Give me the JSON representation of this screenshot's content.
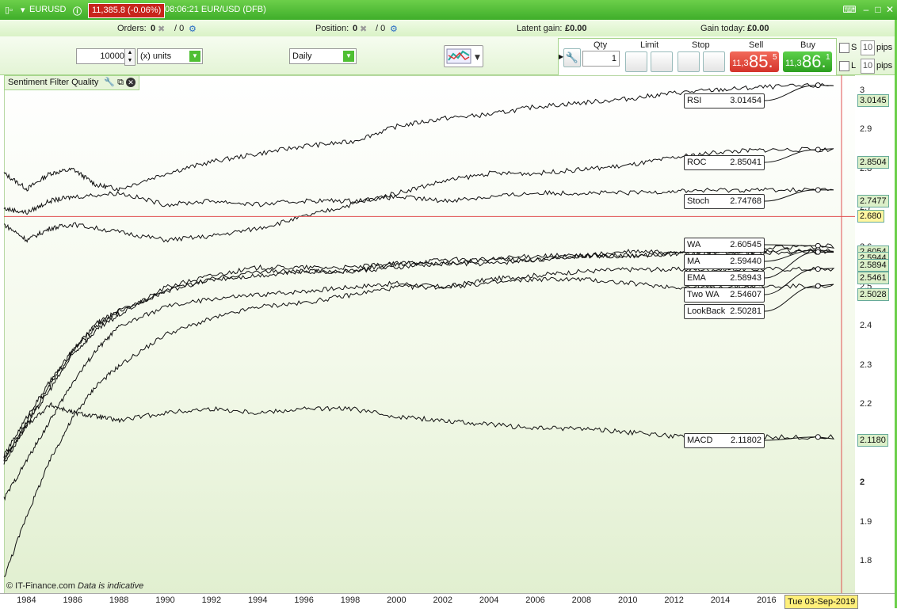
{
  "titlebar": {
    "instrument": "EURUSD",
    "price_change": "11,385.8 (-0.06%)",
    "time_info": "08:06:21 EUR/USD (DFB)"
  },
  "status": {
    "orders_label": "Orders:",
    "orders_value": "0",
    "orders_sep": "/ 0",
    "position_label": "Position:",
    "position_value": "0",
    "position_sep": "/ 0",
    "latent_label": "Latent gain:",
    "latent_value": "£0.00",
    "gain_label": "Gain today:",
    "gain_value": "£0.00"
  },
  "controls": {
    "quantity": "10000",
    "units": "(x) units",
    "timeframe": "Daily"
  },
  "trade": {
    "qty_label": "Qty",
    "qty_value": "1",
    "limit_label": "Limit",
    "stop_label": "Stop",
    "sell_label": "Sell",
    "buy_label": "Buy",
    "sell_small": "11,3",
    "sell_big": "85.",
    "sell_sup": "5",
    "buy_small": "11,3",
    "buy_big": "86.",
    "buy_sup": "1",
    "s_label": "S",
    "l_label": "L",
    "pips_value": "10",
    "pips_label": "pips"
  },
  "panel": {
    "title": "Sentiment Filter Quality"
  },
  "footer": {
    "copyright": "© IT-Finance.com",
    "note": "Data is indicative"
  },
  "crosshair": {
    "value": "2.680",
    "date": "Tue 03-Sep-2019"
  },
  "chart_data": {
    "type": "line",
    "x_range": [
      1983,
      2019.8
    ],
    "y_range": [
      1.72,
      3.04
    ],
    "x_ticks": [
      "1984",
      "1986",
      "1988",
      "1990",
      "1992",
      "1994",
      "1996",
      "1998",
      "2000",
      "2002",
      "2004",
      "2006",
      "2008",
      "2010",
      "2012",
      "2014",
      "2016"
    ],
    "y_ticks": [
      "3",
      "2.9",
      "2.8",
      "2.7",
      "2.6",
      "2.5",
      "2.4",
      "2.3",
      "2.2",
      "2.1",
      "2",
      "1.9",
      "1.8"
    ],
    "series": [
      {
        "name": "RSI",
        "last": "3.01454",
        "axis": "3.0145",
        "points": [
          [
            1983,
            2.79
          ],
          [
            1984,
            2.75
          ],
          [
            1985,
            2.79
          ],
          [
            1986,
            2.8
          ],
          [
            1987,
            2.76
          ],
          [
            1988,
            2.75
          ],
          [
            1990,
            2.79
          ],
          [
            1992,
            2.82
          ],
          [
            1994,
            2.84
          ],
          [
            1996,
            2.86
          ],
          [
            1998,
            2.87
          ],
          [
            2000,
            2.91
          ],
          [
            2002,
            2.93
          ],
          [
            2004,
            2.94
          ],
          [
            2006,
            2.96
          ],
          [
            2008,
            2.97
          ],
          [
            2010,
            2.98
          ],
          [
            2012,
            2.995
          ],
          [
            2014,
            3.003
          ],
          [
            2016,
            3.01
          ],
          [
            2019,
            3.0145
          ]
        ]
      },
      {
        "name": "ROC",
        "last": "2.85041",
        "axis": "2.8504",
        "points": [
          [
            1983,
            2.66
          ],
          [
            1984,
            2.62
          ],
          [
            1985,
            2.65
          ],
          [
            1986,
            2.66
          ],
          [
            1988,
            2.64
          ],
          [
            1990,
            2.62
          ],
          [
            1992,
            2.63
          ],
          [
            1994,
            2.65
          ],
          [
            1996,
            2.68
          ],
          [
            1998,
            2.71
          ],
          [
            2000,
            2.74
          ],
          [
            2002,
            2.77
          ],
          [
            2004,
            2.79
          ],
          [
            2006,
            2.79
          ],
          [
            2008,
            2.8
          ],
          [
            2010,
            2.81
          ],
          [
            2012,
            2.83
          ],
          [
            2014,
            2.845
          ],
          [
            2016,
            2.85
          ],
          [
            2019,
            2.8504
          ]
        ]
      },
      {
        "name": "Stoch",
        "last": "2.74768",
        "axis": "2.7477",
        "points": [
          [
            1983,
            2.7
          ],
          [
            1984,
            2.69
          ],
          [
            1985,
            2.72
          ],
          [
            1986,
            2.73
          ],
          [
            1988,
            2.74
          ],
          [
            1990,
            2.71
          ],
          [
            1992,
            2.72
          ],
          [
            1994,
            2.71
          ],
          [
            1996,
            2.72
          ],
          [
            1998,
            2.72
          ],
          [
            2000,
            2.73
          ],
          [
            2002,
            2.72
          ],
          [
            2004,
            2.73
          ],
          [
            2006,
            2.74
          ],
          [
            2008,
            2.74
          ],
          [
            2010,
            2.74
          ],
          [
            2012,
            2.745
          ],
          [
            2014,
            2.747
          ],
          [
            2016,
            2.748
          ],
          [
            2019,
            2.7477
          ]
        ]
      },
      {
        "name": "WA",
        "last": "2.60545",
        "axis": "2.6054",
        "points": [
          [
            1983,
            2.05
          ],
          [
            1984,
            2.15
          ],
          [
            1985,
            2.24
          ],
          [
            1986,
            2.33
          ],
          [
            1987,
            2.39
          ],
          [
            1988,
            2.43
          ],
          [
            1990,
            2.5
          ],
          [
            1992,
            2.53
          ],
          [
            1994,
            2.55
          ],
          [
            1996,
            2.55
          ],
          [
            1998,
            2.55
          ],
          [
            2000,
            2.56
          ],
          [
            2002,
            2.57
          ],
          [
            2004,
            2.57
          ],
          [
            2006,
            2.58
          ],
          [
            2008,
            2.58
          ],
          [
            2010,
            2.59
          ],
          [
            2012,
            2.59
          ],
          [
            2014,
            2.6
          ],
          [
            2016,
            2.6
          ],
          [
            2019,
            2.6054
          ]
        ]
      },
      {
        "name": "MA",
        "last": "2.59440",
        "axis": "2.5944",
        "points": [
          [
            1983,
            2.06
          ],
          [
            1984,
            2.16
          ],
          [
            1985,
            2.25
          ],
          [
            1986,
            2.34
          ],
          [
            1987,
            2.4
          ],
          [
            1988,
            2.44
          ],
          [
            1990,
            2.49
          ],
          [
            1992,
            2.52
          ],
          [
            1994,
            2.54
          ],
          [
            1996,
            2.54
          ],
          [
            1998,
            2.54
          ],
          [
            2000,
            2.56
          ],
          [
            2002,
            2.56
          ],
          [
            2004,
            2.57
          ],
          [
            2006,
            2.57
          ],
          [
            2008,
            2.58
          ],
          [
            2010,
            2.58
          ],
          [
            2012,
            2.585
          ],
          [
            2014,
            2.59
          ],
          [
            2016,
            2.592
          ],
          [
            2019,
            2.5944
          ]
        ]
      },
      {
        "name": "EMA",
        "last": "2.58943",
        "axis": "2.5894",
        "points": [
          [
            1983,
            2.07
          ],
          [
            1984,
            2.17
          ],
          [
            1985,
            2.26
          ],
          [
            1986,
            2.34
          ],
          [
            1987,
            2.41
          ],
          [
            1988,
            2.44
          ],
          [
            1990,
            2.49
          ],
          [
            1992,
            2.52
          ],
          [
            1994,
            2.53
          ],
          [
            1996,
            2.54
          ],
          [
            1998,
            2.54
          ],
          [
            2000,
            2.55
          ],
          [
            2002,
            2.56
          ],
          [
            2004,
            2.56
          ],
          [
            2006,
            2.57
          ],
          [
            2008,
            2.58
          ],
          [
            2010,
            2.58
          ],
          [
            2012,
            2.585
          ],
          [
            2014,
            2.587
          ],
          [
            2016,
            2.588
          ],
          [
            2019,
            2.5894
          ]
        ]
      },
      {
        "name": "Two WA",
        "last": "2.54607",
        "axis": "2.5461",
        "points": [
          [
            1983,
            1.96
          ],
          [
            1984,
            2.06
          ],
          [
            1985,
            2.16
          ],
          [
            1986,
            2.26
          ],
          [
            1987,
            2.34
          ],
          [
            1988,
            2.4
          ],
          [
            1990,
            2.45
          ],
          [
            1992,
            2.47
          ],
          [
            1994,
            2.48
          ],
          [
            1996,
            2.49
          ],
          [
            1998,
            2.5
          ],
          [
            2000,
            2.51
          ],
          [
            2002,
            2.5
          ],
          [
            2004,
            2.52
          ],
          [
            2006,
            2.53
          ],
          [
            2008,
            2.54
          ],
          [
            2010,
            2.545
          ],
          [
            2012,
            2.545
          ],
          [
            2014,
            2.545
          ],
          [
            2016,
            2.546
          ],
          [
            2019,
            2.5461
          ]
        ]
      },
      {
        "name": "LookBack",
        "last": "2.50281",
        "axis": "2.5028",
        "points": [
          [
            1983,
            1.76
          ],
          [
            1984,
            1.92
          ],
          [
            1985,
            2.06
          ],
          [
            1986,
            2.17
          ],
          [
            1987,
            2.25
          ],
          [
            1988,
            2.3
          ],
          [
            1990,
            2.38
          ],
          [
            1992,
            2.42
          ],
          [
            1994,
            2.45
          ],
          [
            1996,
            2.46
          ],
          [
            1998,
            2.48
          ],
          [
            2000,
            2.5
          ],
          [
            2002,
            2.5
          ],
          [
            2004,
            2.51
          ],
          [
            2006,
            2.52
          ],
          [
            2008,
            2.52
          ],
          [
            2010,
            2.51
          ],
          [
            2012,
            2.5
          ],
          [
            2014,
            2.5
          ],
          [
            2016,
            2.502
          ],
          [
            2019,
            2.5028
          ]
        ]
      },
      {
        "name": "MACD",
        "last": "2.11802",
        "axis": "2.1180",
        "points": [
          [
            1983,
            2.06
          ],
          [
            1984,
            2.15
          ],
          [
            1985,
            2.2
          ],
          [
            1986,
            2.18
          ],
          [
            1987,
            2.17
          ],
          [
            1988,
            2.16
          ],
          [
            1990,
            2.18
          ],
          [
            1992,
            2.19
          ],
          [
            1994,
            2.18
          ],
          [
            1996,
            2.19
          ],
          [
            1998,
            2.19
          ],
          [
            2000,
            2.17
          ],
          [
            2002,
            2.16
          ],
          [
            2004,
            2.15
          ],
          [
            2006,
            2.14
          ],
          [
            2008,
            2.14
          ],
          [
            2010,
            2.13
          ],
          [
            2012,
            2.12
          ],
          [
            2014,
            2.12
          ],
          [
            2016,
            2.118
          ],
          [
            2019,
            2.118
          ]
        ]
      }
    ]
  }
}
